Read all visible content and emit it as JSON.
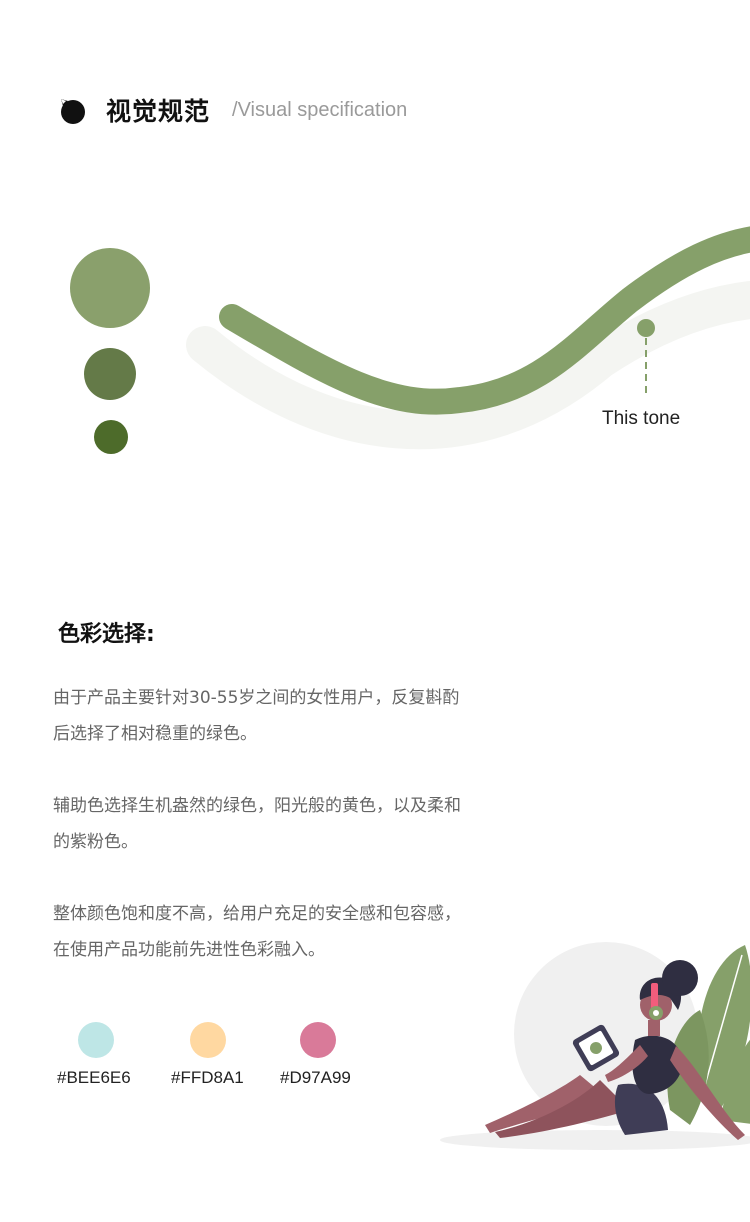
{
  "header": {
    "title": "视觉规范",
    "subtitle": "/Visual specification",
    "logo_icon": "cat-head-icon"
  },
  "hero": {
    "tone_label": "This tone",
    "tone_circles": [
      "#8AA06C",
      "#647A48",
      "#4D6B2A"
    ],
    "curve_color": "#86A06A",
    "shadow_color": "#F5F6F4"
  },
  "color_section": {
    "title": "色彩选择:",
    "paragraphs": [
      "由于产品主要针对30-55岁之间的女性用户，反复斟酌后选择了相对稳重的绿色。",
      "辅助色选择生机盎然的绿色，阳光般的黄色，以及柔和的紫粉色。",
      "整体颜色饱和度不高，给用户充足的安全感和包容感，在使用产品功能前先进性色彩融入。"
    ],
    "swatches": [
      {
        "color": "#BEE6E6",
        "label": "#BEE6E6"
      },
      {
        "color": "#FFD8A1",
        "label": "#FFD8A1"
      },
      {
        "color": "#D97A99",
        "label": "#D97A99"
      }
    ]
  },
  "illustration": {
    "subject": "woman-reading-tablet-with-headphones",
    "icons": [
      "headphones-icon",
      "tablet-icon",
      "plant-leaves-icon"
    ]
  }
}
